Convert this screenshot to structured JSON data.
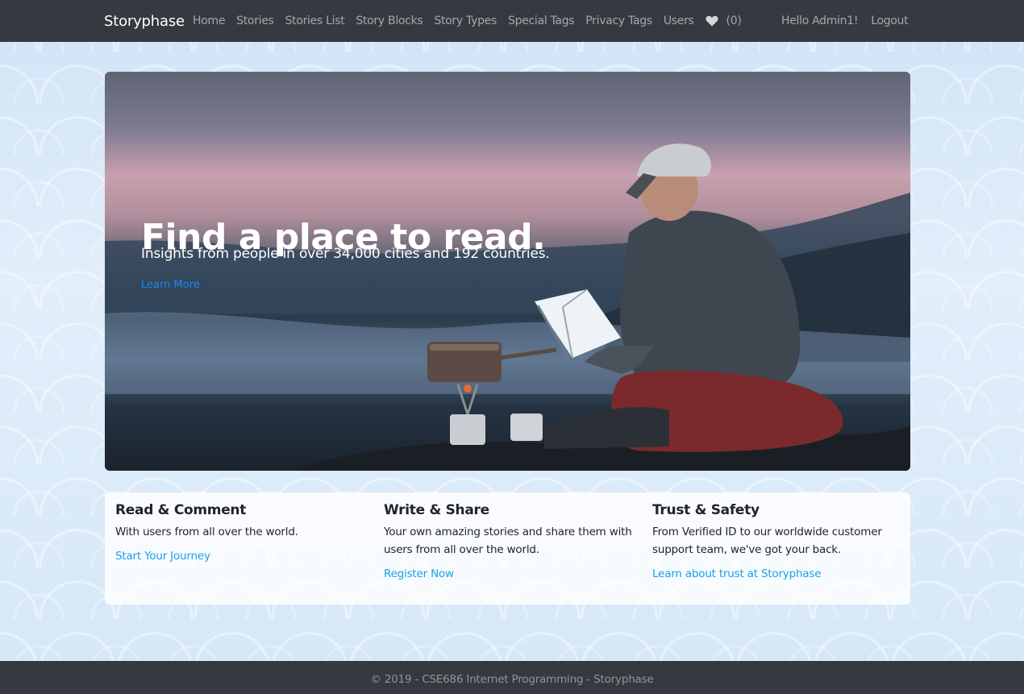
{
  "navbar": {
    "brand": "Storyphase",
    "links": [
      "Home",
      "Stories",
      "Stories List",
      "Story Blocks",
      "Story Types",
      "Special Tags",
      "Privacy Tags",
      "Users"
    ],
    "favorites_count": "(0)",
    "greeting": "Hello Admin1!",
    "logout": "Logout"
  },
  "hero": {
    "title": "Find a place to read.",
    "subtitle": "Insights from people in over 34,000 cities and 192 countries.",
    "link": "Learn More"
  },
  "features": [
    {
      "heading": "Read & Comment",
      "text": "With users from all over the world.",
      "link": "Start Your Journey"
    },
    {
      "heading": "Write & Share",
      "text": "Your own amazing stories and share them with users from all over the world.",
      "link": "Register Now"
    },
    {
      "heading": "Trust & Safety",
      "text": "From Verified ID to our worldwide customer support team, we've got your back.",
      "link": "Learn about trust at Storyphase"
    }
  ],
  "footer": {
    "text": "© 2019 - CSE686 Internet Programming - Storyphase"
  },
  "colors": {
    "navbar_bg": "#343a40",
    "link": "#17a2e8",
    "hero_link": "#1a86f5"
  }
}
